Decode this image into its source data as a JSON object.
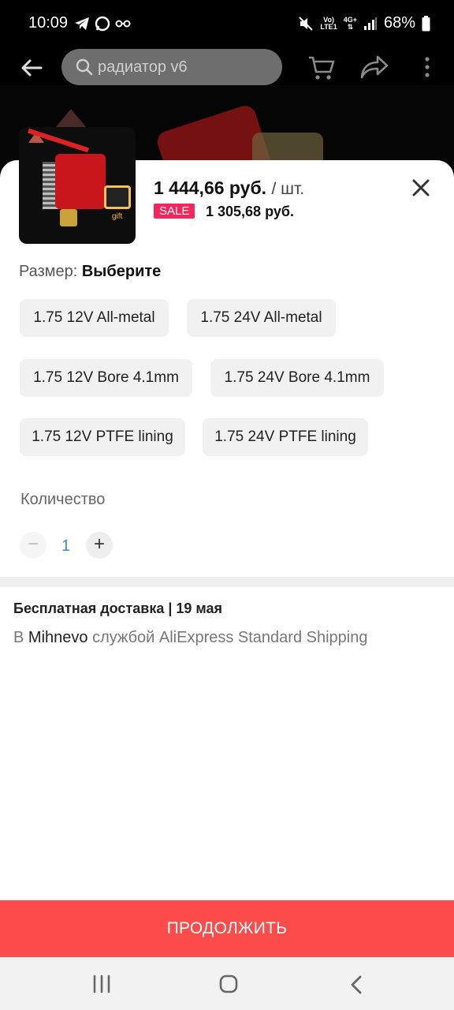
{
  "status_bar": {
    "time": "10:09",
    "battery": "68%",
    "net_small_1": "Vo)",
    "net_small_2": "LTE1",
    "net_small_3": "4G+"
  },
  "search": {
    "placeholder": "радиатор v6"
  },
  "product": {
    "price": "1 444,66 руб.",
    "unit": "/ шт.",
    "sale_badge": "SALE",
    "sale_price": "1 305,68 руб.",
    "gift_label": "gift"
  },
  "size": {
    "label": "Размер:",
    "value": "Выберите"
  },
  "options": [
    "1.75 12V All-metal",
    "1.75 24V All-metal",
    "1.75 12V Bore 4.1mm",
    "1.75 24V Bore 4.1mm",
    "1.75 12V PTFE lining",
    "1.75 24V PTFE lining"
  ],
  "quantity": {
    "label": "Количество",
    "minus": "−",
    "value": "1",
    "plus": "+"
  },
  "shipping": {
    "title": "Бесплатная доставка | 19 мая",
    "prefix": "В ",
    "city": "Mihnevo",
    "suffix": " службой AliExpress Standard Shipping"
  },
  "continue_label": "ПРОДОЛЖИТЬ"
}
